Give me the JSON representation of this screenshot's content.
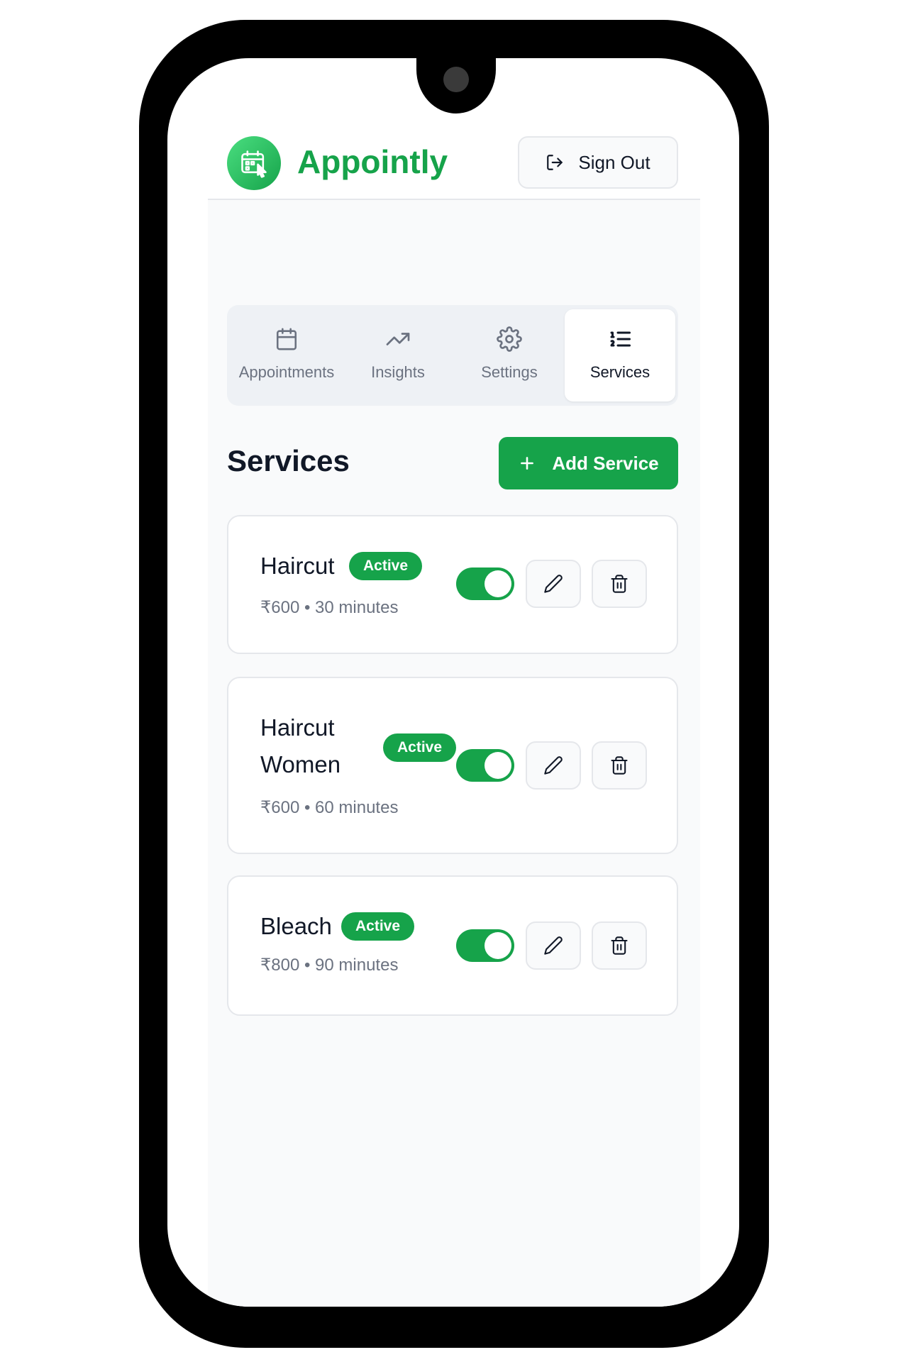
{
  "app": {
    "name": "Appointly",
    "logo_icon": "calendar-cursor-icon",
    "brand_color": "#16a34a"
  },
  "header": {
    "signout_label": "Sign Out",
    "signout_icon": "logout-icon"
  },
  "tabs": [
    {
      "label": "Appointments",
      "icon": "calendar-icon",
      "active": false
    },
    {
      "label": "Insights",
      "icon": "trending-up-icon",
      "active": false
    },
    {
      "label": "Settings",
      "icon": "gear-icon",
      "active": false
    },
    {
      "label": "Services",
      "icon": "list-ordered-icon",
      "active": true
    }
  ],
  "section": {
    "title": "Services",
    "add_label": "Add Service",
    "add_icon": "plus-icon"
  },
  "services": [
    {
      "name": "Haircut",
      "status": "Active",
      "meta": "₹600 • 30 minutes",
      "enabled": true
    },
    {
      "name": "Haircut Women",
      "name_line1": "Haircut",
      "name_line2": "Women",
      "status": "Active",
      "meta": "₹600 • 60 minutes",
      "enabled": true
    },
    {
      "name": "Bleach",
      "status": "Active",
      "meta": "₹800 • 90 minutes",
      "enabled": true
    }
  ]
}
